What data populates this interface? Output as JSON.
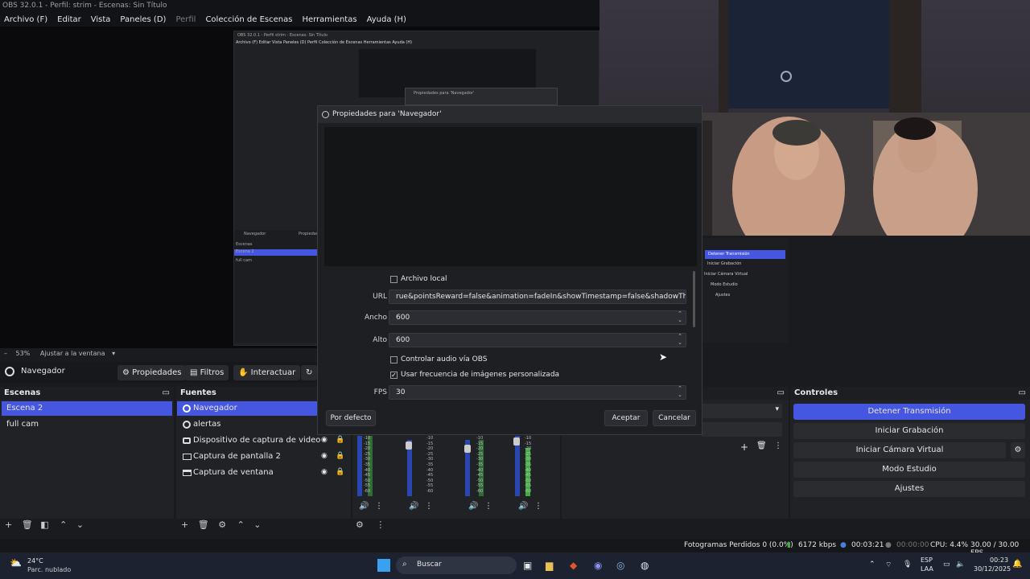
{
  "window": {
    "title": "OBS 32.0.1 - Perfil: strim - Escenas: Sin Título"
  },
  "menu": [
    {
      "label": "Archivo (F)",
      "dim": false
    },
    {
      "label": "Editar",
      "dim": false
    },
    {
      "label": "Vista",
      "dim": false
    },
    {
      "label": "Paneles (D)",
      "dim": false
    },
    {
      "label": "Perfil",
      "dim": true
    },
    {
      "label": "Colección de Escenas",
      "dim": false
    },
    {
      "label": "Herramientas",
      "dim": false
    },
    {
      "label": "Ayuda (H)",
      "dim": false
    }
  ],
  "nested_preview": {
    "title": "OBS 32.0.1 - Perfil strim - Escenas: Sin Título",
    "menu": "Archivo (F)  Editar  Vista  Paneles (D)  Perfil  Colección de Escenas  Herramientas  Ayuda (H)",
    "dialog_title": "Propiedades para 'Navegador'",
    "source_label": "Navegador",
    "properties_label": "Propiedades",
    "scenes_label": "Escenas",
    "scenes": [
      "Escena 2",
      "full cam"
    ],
    "controls": [
      "Detener Transmisión",
      "Iniciar Grabación",
      "Iniciar Cámara Virtual",
      "Modo Estudio",
      "Ajustes"
    ]
  },
  "zoom": {
    "value": "53%",
    "fit_label": "Ajustar a la ventana"
  },
  "dialog": {
    "title": "Propiedades para 'Navegador'",
    "local_file_label": "Archivo local",
    "local_file_checked": false,
    "url_label": "URL",
    "url_value": "rue&pointsReward=false&animation=fadeIn&showTimestamp=false&shadowThickness=4",
    "width_label": "Ancho",
    "width_value": "600",
    "height_label": "Alto",
    "height_value": "600",
    "control_audio_label": "Controlar audio vía OBS",
    "control_audio_checked": false,
    "custom_fps_label": "Usar frecuencia de imágenes personalizada",
    "custom_fps_checked": true,
    "fps_label": "FPS",
    "fps_value": "30",
    "default_button": "Por defecto",
    "ok_button": "Aceptar",
    "cancel_button": "Cancelar"
  },
  "source_toolbar": {
    "source_name": "Navegador",
    "properties": "Propiedades",
    "filters": "Filtros",
    "interact": "Interactuar"
  },
  "scenes": {
    "header": "Escenas",
    "items": [
      {
        "label": "Escena 2",
        "selected": true
      },
      {
        "label": "full cam",
        "selected": false
      }
    ]
  },
  "sources": {
    "header": "Fuentes",
    "items": [
      {
        "label": "Navegador",
        "icon": "globe-icon",
        "selected": true
      },
      {
        "label": "alertas",
        "icon": "globe-icon",
        "selected": false
      },
      {
        "label": "Dispositivo de captura de video",
        "icon": "camera-icon",
        "selected": false
      },
      {
        "label": "Captura de pantalla 2",
        "icon": "monitor-icon",
        "selected": false
      },
      {
        "label": "Captura de ventana",
        "icon": "window-icon",
        "selected": false
      }
    ]
  },
  "meter_ticks": [
    "-10",
    "-15",
    "-20",
    "-25",
    "-30",
    "-35",
    "-40",
    "-45",
    "-50",
    "-55",
    "-60"
  ],
  "controls": {
    "header": "Controles",
    "buttons": [
      {
        "label": "Detener Transmisión",
        "active": true
      },
      {
        "label": "Iniciar Grabación",
        "active": false
      },
      {
        "label": "Iniciar Cámara Virtual",
        "active": false
      },
      {
        "label": "Modo Estudio",
        "active": false
      },
      {
        "label": "Ajustes",
        "active": false
      }
    ]
  },
  "status": {
    "dropped_frames": "Fotogramas Perdidos 0 (0.0%)",
    "bitrate": "6172 kbps",
    "stream_time": "00:03:21",
    "rec_time": "00:00:00",
    "cpu": "CPU: 4.4%",
    "fps": "30.00 / 30.00 FPS"
  },
  "taskbar": {
    "weather_temp": "24°C",
    "weather_desc": "Parc. nublado",
    "search_label": "Buscar",
    "lang_top": "ESP",
    "lang_bottom": "LAA",
    "time": "00:23",
    "date": "30/12/2025"
  },
  "colors": {
    "accent": "#4556e0",
    "bg": "#1a1b1e",
    "panel": "#212225"
  }
}
